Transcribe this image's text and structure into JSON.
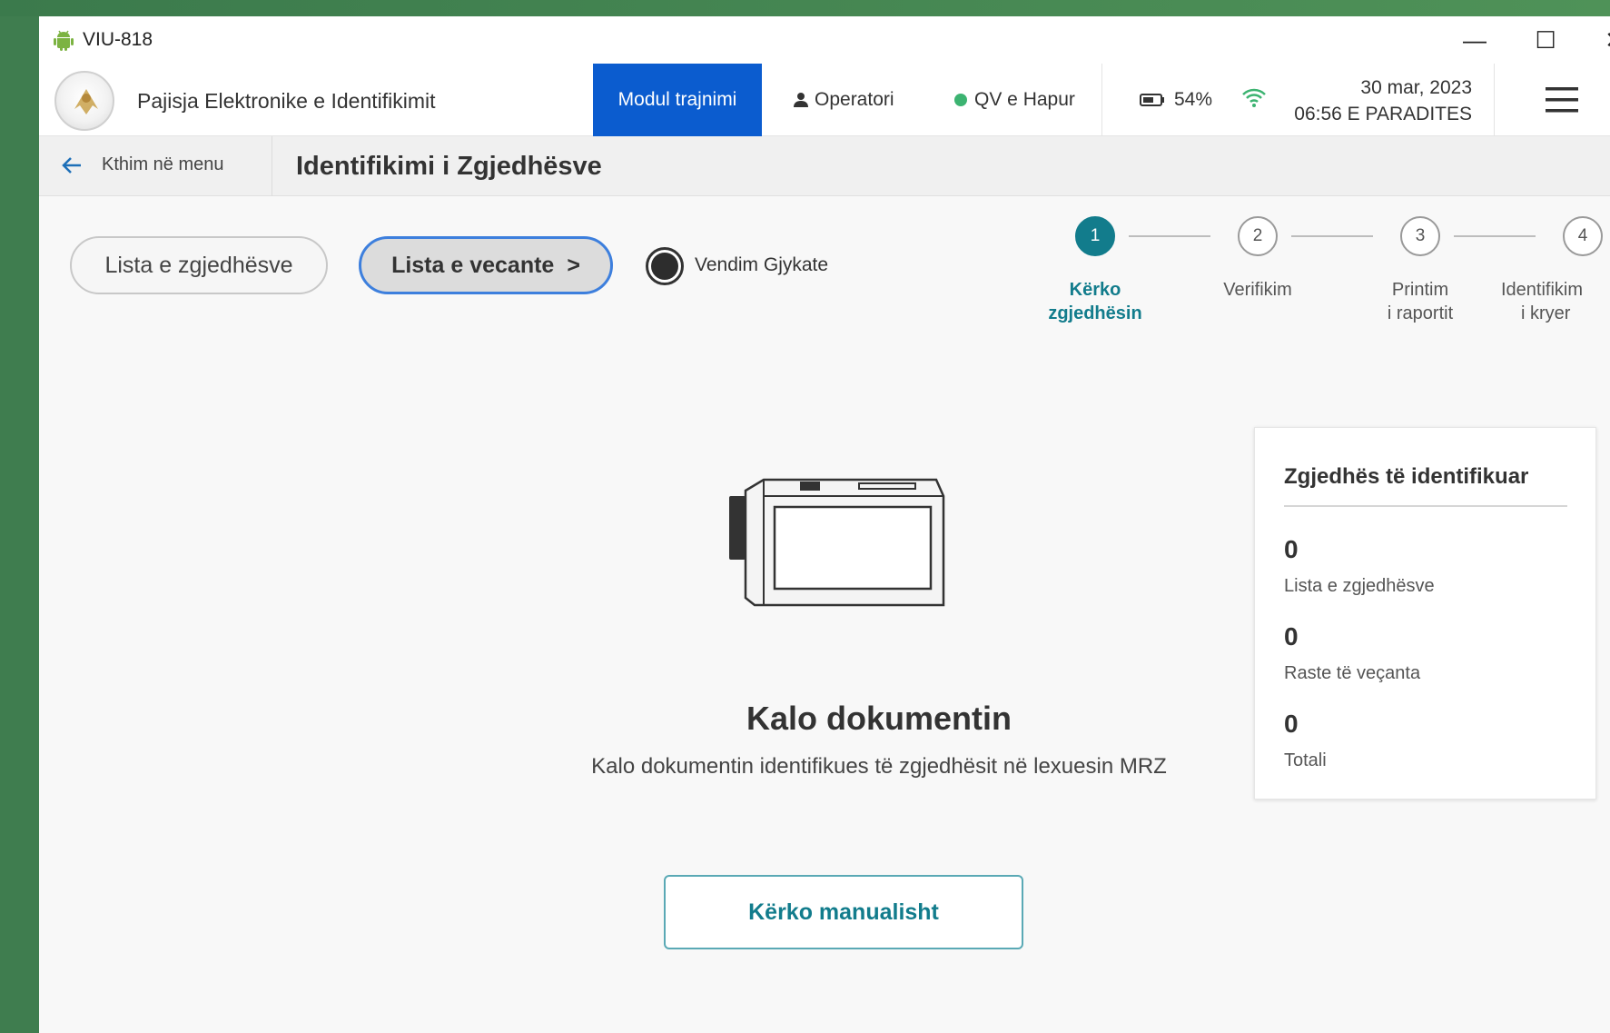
{
  "window": {
    "title": "VIU-818",
    "controls": {
      "minimize": "—",
      "maximize": "☐",
      "close": "✕"
    }
  },
  "header": {
    "app_name": "Pajisja Elektronike e Identifikimit",
    "training_mode": "Modul trajnimi",
    "operator": "Operatori",
    "qv_status": "QV e Hapur",
    "battery": "54%",
    "date": "30 mar, 2023",
    "time": "06:56 E PARADITES"
  },
  "subheader": {
    "back_label": "Kthim në menu",
    "page_title": "Identifikimi i Zgjedhësve"
  },
  "filters": {
    "list_voters": "Lista e zgjedhësve",
    "special_list": "Lista e vecante",
    "special_chevron": ">",
    "court_decision": "Vendim Gjykate"
  },
  "stepper": {
    "steps": [
      {
        "number": "1",
        "line1": "Kërko",
        "line2": "zgjedhësin",
        "active": true
      },
      {
        "number": "2",
        "line1": "Verifikim",
        "line2": "",
        "active": false
      },
      {
        "number": "3",
        "line1": "Printim",
        "line2": "i raportit",
        "active": false
      },
      {
        "number": "4",
        "line1": "Identifikim",
        "line2": "i kryer",
        "active": false
      }
    ]
  },
  "main": {
    "title": "Kalo dokumentin",
    "subtitle": "Kalo dokumentin identifikues të zgjedhësit në lexuesin MRZ",
    "manual_button": "Kërko manualisht"
  },
  "stats": {
    "title": "Zgjedhës të identifikuar",
    "items": [
      {
        "value": "0",
        "label": "Lista e zgjedhësve"
      },
      {
        "value": "0",
        "label": "Raste të veçanta"
      },
      {
        "value": "0",
        "label": "Totali"
      }
    ]
  },
  "colors": {
    "accent_teal": "#127c8c",
    "training_blue": "#0b5ccf",
    "status_green": "#3cb371",
    "desktop_green": "#3f7d4f"
  },
  "icons": [
    "android-icon",
    "user-icon",
    "status-dot-icon",
    "battery-icon",
    "wifi-icon",
    "hamburger-menu-icon",
    "back-arrow-icon",
    "chevron-right-icon",
    "mrz-reader-icon"
  ]
}
